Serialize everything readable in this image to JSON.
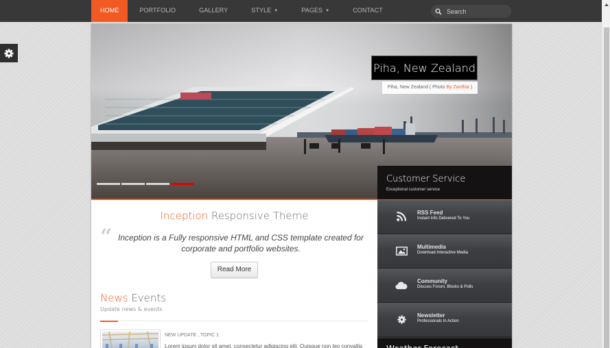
{
  "nav": {
    "items": [
      {
        "label": "HOME",
        "active": true,
        "dropdown": false
      },
      {
        "label": "PORTFOLIO",
        "active": false,
        "dropdown": false
      },
      {
        "label": "GALLERY",
        "active": false,
        "dropdown": false
      },
      {
        "label": "STYLE",
        "active": false,
        "dropdown": true
      },
      {
        "label": "PAGES",
        "active": false,
        "dropdown": true
      },
      {
        "label": "CONTACT",
        "active": false,
        "dropdown": false
      }
    ],
    "search_placeholder": "Search",
    "accent_color": "#f15a22"
  },
  "slider": {
    "title": "Piha, New Zealand",
    "caption_prefix": "Piha, New Zealand ( Photo ",
    "caption_credit": "By Zanthia",
    "caption_suffix": " )",
    "slide_count": 4,
    "active_slide": 4
  },
  "customer_service": {
    "title": "Customer Service",
    "subtitle": "Exceptional customer service",
    "features": [
      {
        "icon": "rss-icon",
        "title": "RSS Feed",
        "subtitle": "Instant Info Delivered To You"
      },
      {
        "icon": "image-icon",
        "title": "Multimedia",
        "subtitle": "Download Interactive Media"
      },
      {
        "icon": "cloud-icon",
        "title": "Community",
        "subtitle": "Discuss Forum, Blocks & Polls"
      },
      {
        "icon": "gear-icon",
        "title": "Newsletter",
        "subtitle": "Professionals In Action"
      }
    ],
    "next_section_title": "Weather Forecast"
  },
  "intro": {
    "title_accent": "Inception",
    "title_rest": " Responsive Theme",
    "text": "Inception is a Fully responsive HTML and CSS template created for corporate and portfolio websites.",
    "button_label": "Read More"
  },
  "news": {
    "title_accent": "News",
    "title_rest": " Events",
    "subtitle": "Update news & events",
    "items": [
      {
        "topic": "NEW UPDATE , TOPIC 1",
        "text": "Lorem ipsum dolor sit amet, consectetur adipiscing elit. Quisque non leo convallis"
      }
    ]
  }
}
